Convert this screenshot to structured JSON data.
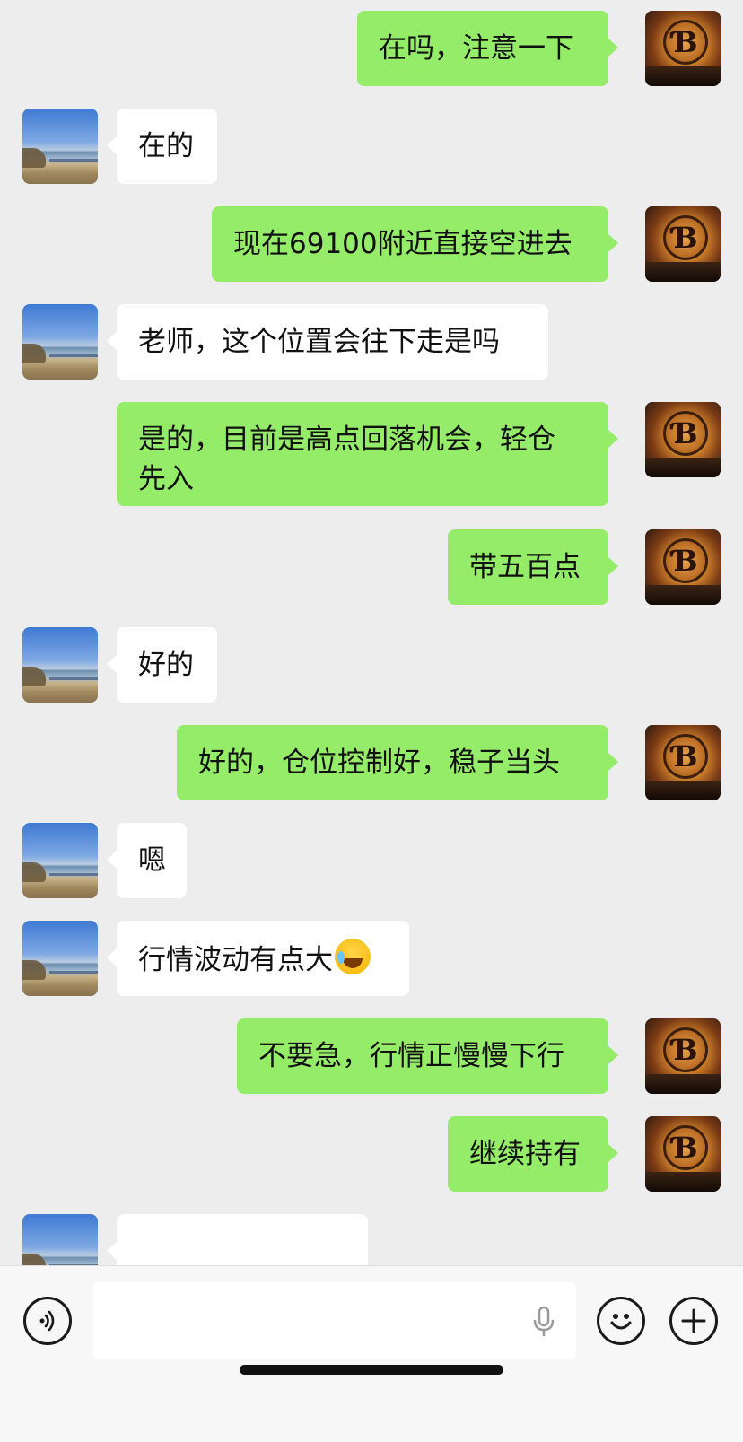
{
  "messages": [
    {
      "dir": "out",
      "text": "在吗，注意一下"
    },
    {
      "dir": "in",
      "text": "在的"
    },
    {
      "dir": "out",
      "text": "现在69100附近直接空进去"
    },
    {
      "dir": "in",
      "text": "老师，这个位置会往下走是吗"
    },
    {
      "dir": "out",
      "text": "是的，目前是高点回落机会，轻仓\n先入"
    },
    {
      "dir": "out",
      "text": "带五百点"
    },
    {
      "dir": "in",
      "text": "好的"
    },
    {
      "dir": "out",
      "text": "好的，仓位控制好，稳子当头"
    },
    {
      "dir": "in",
      "text": "嗯"
    },
    {
      "dir": "in",
      "text": "行情波动有点大",
      "emoji": "crying-laughing-emoji"
    },
    {
      "dir": "out",
      "text": "不要急，行情正慢慢下行"
    },
    {
      "dir": "out",
      "text": "继续持有"
    },
    {
      "dir": "in",
      "text": ""
    }
  ],
  "avatars": {
    "contact": "lake-landscape-avatar",
    "self": "bitcoin-sunset-avatar",
    "self_symbol": "Ɓ"
  },
  "input_bar": {
    "placeholder": "",
    "icons": [
      "voice-icon",
      "microphone-icon",
      "emoji-icon",
      "plus-icon"
    ]
  },
  "colors": {
    "background": "#ededed",
    "outgoing_bubble": "#95ec69",
    "incoming_bubble": "#ffffff"
  }
}
